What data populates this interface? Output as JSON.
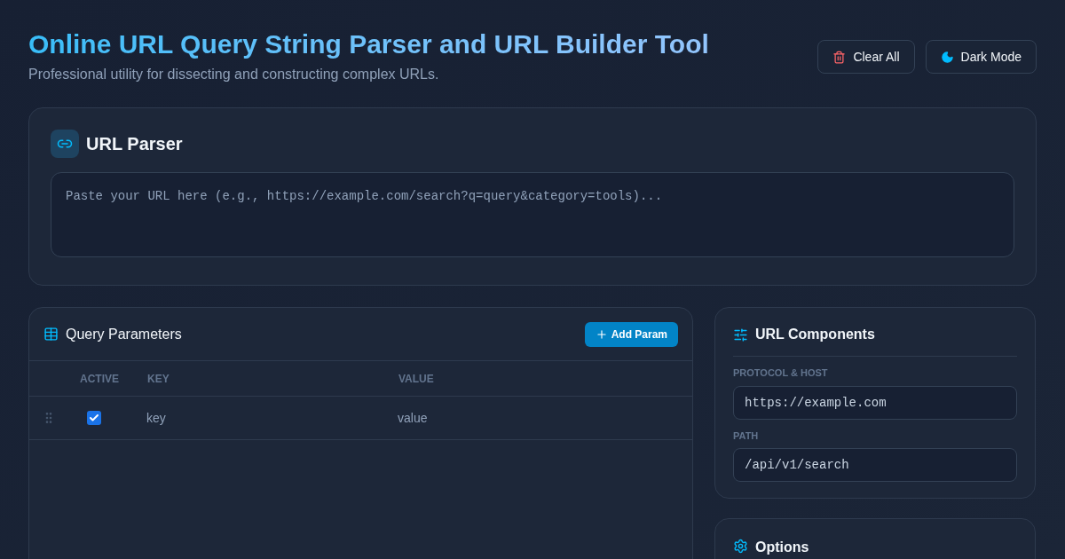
{
  "header": {
    "title": "Online URL Query String Parser and URL Builder Tool",
    "subtitle": "Professional utility for dissecting and constructing complex URLs.",
    "buttons": [
      {
        "kind": "clear",
        "label": "Clear All"
      },
      {
        "kind": "theme",
        "label": "Dark Mode"
      }
    ]
  },
  "parser": {
    "title": "URL Parser",
    "placeholder": "Paste your URL here (e.g., https://example.com/search?q=query&category=tools)..."
  },
  "params": {
    "title": "Query Parameters",
    "add_button": "Add Param",
    "columns": [
      "ACTIVE",
      "KEY",
      "VALUE"
    ],
    "rows": [
      {
        "checked": true,
        "key": "key",
        "value": "value"
      }
    ]
  },
  "components": {
    "title": "URL Components",
    "fields": [
      {
        "label": "PROTOCOL & HOST",
        "value": "https://example.com"
      },
      {
        "label": "PATH",
        "value": "/api/v1/search"
      }
    ]
  },
  "options": {
    "title": "Options"
  }
}
